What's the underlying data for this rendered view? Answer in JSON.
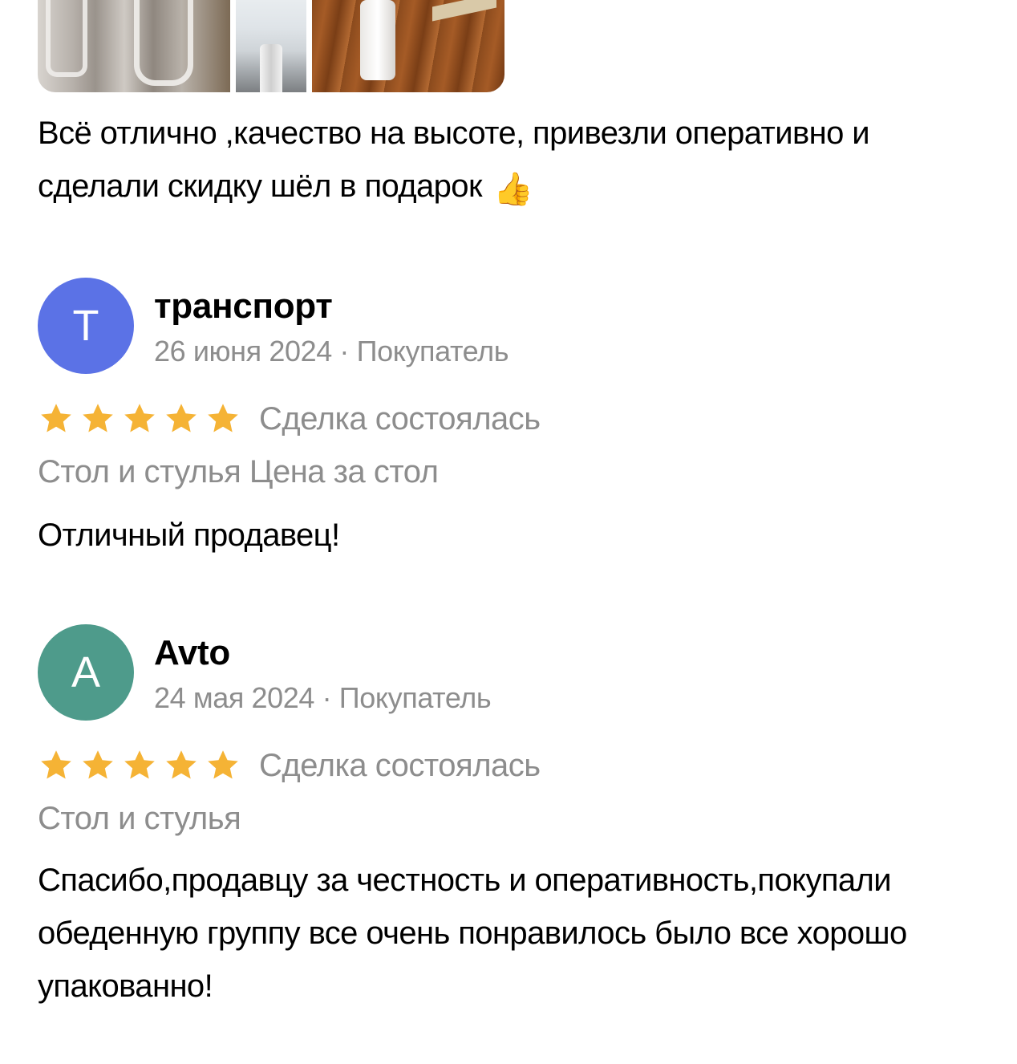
{
  "top_review": {
    "text": "Всё отлично ,качество на высоте, привезли оперативно и сделали скидку шёл в подарок",
    "emoji": "👍",
    "photos": [
      "photo-chairs",
      "photo-table-top",
      "photo-table-leg"
    ]
  },
  "reviews": [
    {
      "avatar_letter": "Т",
      "avatar_color": "#5b72e6",
      "author": "транспорт",
      "meta": "26 июня 2024 · Покупатель",
      "rating": 5,
      "deal_status": "Сделка состоялась",
      "item": "Стол и стулья Цена за стол",
      "text": "Отличный продавец!"
    },
    {
      "avatar_letter": "А",
      "avatar_color": "#4e9b8b",
      "author": "Avto",
      "meta": "24 мая 2024 · Покупатель",
      "rating": 5,
      "deal_status": "Сделка состоялась",
      "item": "Стол и стулья",
      "text": "Спасибо,продавцу за честность и оперативность,покупали обеденную группу все очень понравилось было все хорошо упакованно!"
    }
  ],
  "colors": {
    "star": "#f5b335",
    "secondary_text": "#8d8d8d",
    "primary_text": "#000000"
  }
}
